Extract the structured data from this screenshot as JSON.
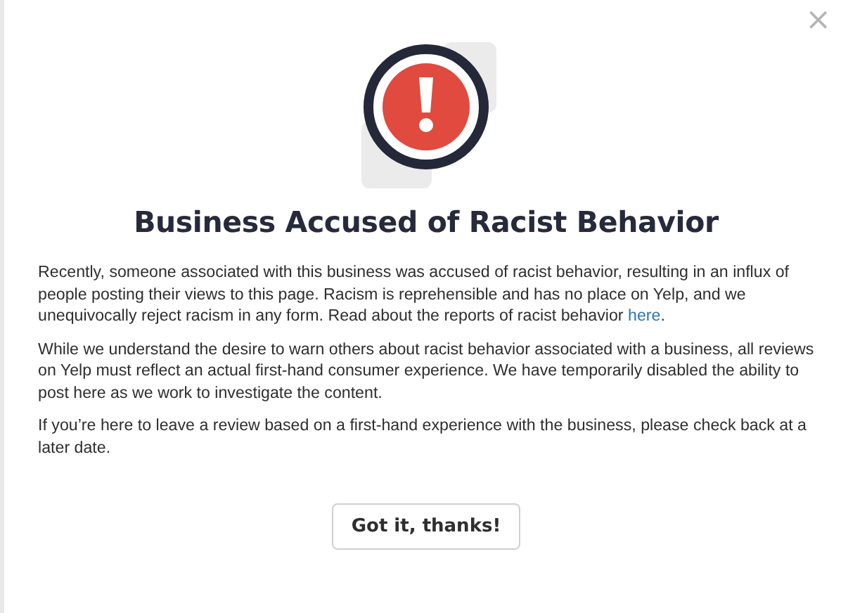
{
  "dialog": {
    "close": "×",
    "title": "Business Accused of Racist Behavior",
    "paragraphs": [
      {
        "text": "Recently, someone associated with this business was accused of racist behavior, resulting in an influx of people posting their views to this page. Racism is reprehensible and has no place on Yelp, and we unequivocally reject racism in any form. Read about the reports of racist behavior ",
        "link": "here",
        "after": "."
      },
      {
        "text": "While we understand the desire to warn others about racist behavior associated with a business, all reviews on Yelp must reflect an actual first-hand consumer experience. We have temporarily disabled the ability to post here as we work to investigate the content."
      },
      {
        "text": "If you’re here to leave a review based on a first-hand experience with the business, please check back at a later date."
      }
    ],
    "button": "Got it, thanks!"
  }
}
